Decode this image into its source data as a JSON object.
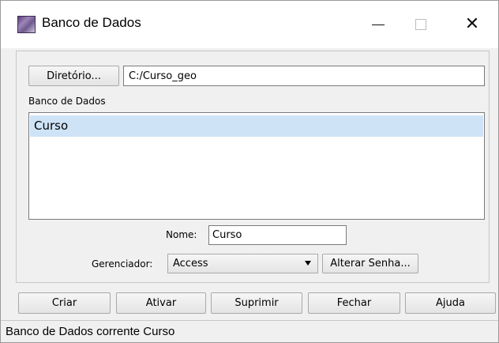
{
  "window": {
    "title": "Banco de Dados",
    "controls": {
      "minimize": "—",
      "close": "✕"
    }
  },
  "directory": {
    "button_label": "Diretório...",
    "path_value": "C:/Curso_geo"
  },
  "database_list": {
    "label": "Banco de Dados",
    "items": [
      "Curso"
    ],
    "selected": "Curso"
  },
  "name_field": {
    "label": "Nome:",
    "value": "Curso"
  },
  "manager": {
    "label": "Gerenciador:",
    "selected": "Access",
    "change_password_label": "Alterar Senha..."
  },
  "actions": {
    "create": "Criar",
    "activate": "Ativar",
    "delete": "Suprimir",
    "close": "Fechar",
    "help": "Ajuda"
  },
  "status": {
    "text": "Banco de Dados corrente Curso"
  },
  "colors": {
    "selection": "#cfe3f7",
    "window_bg": "#f0f0f0"
  }
}
